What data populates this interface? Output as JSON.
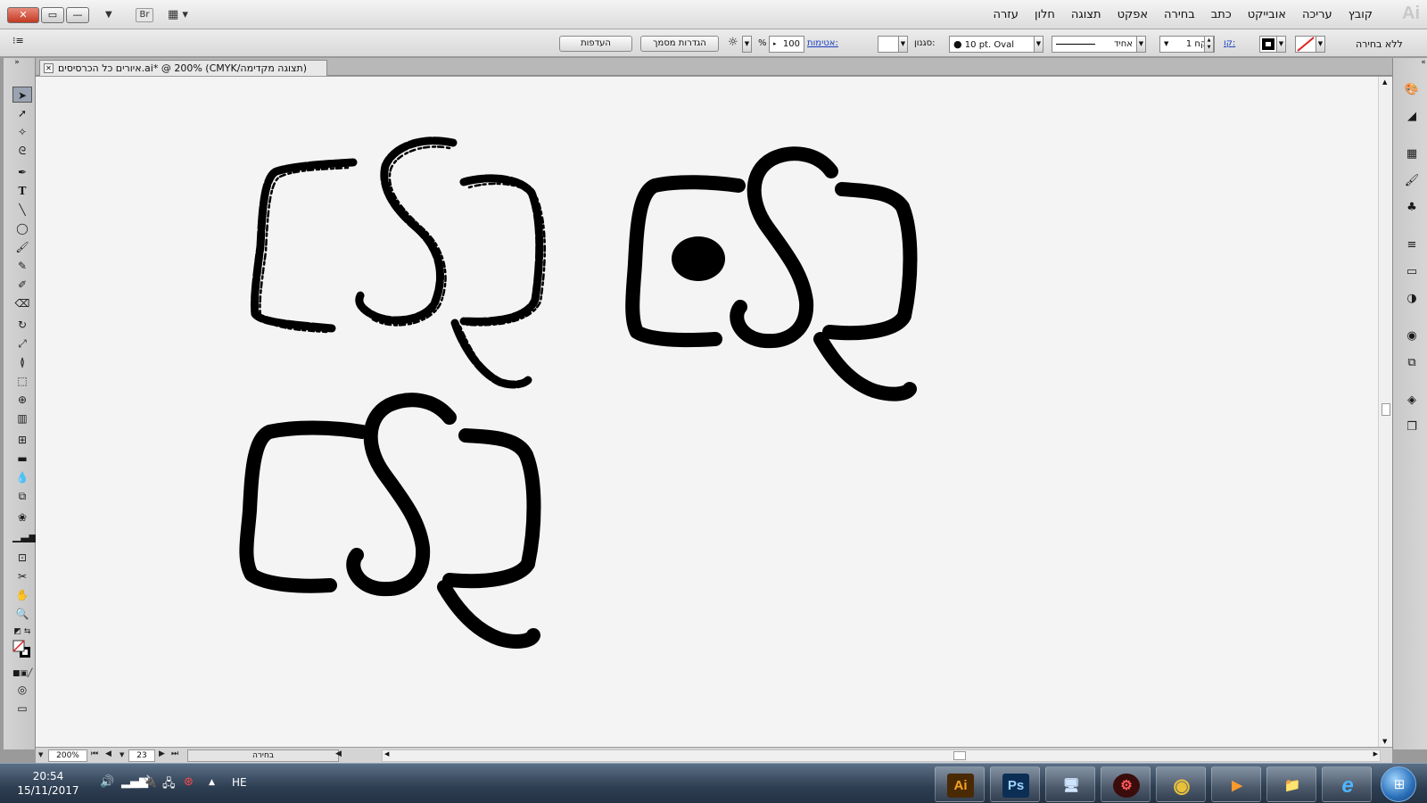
{
  "window": {
    "close_glyph": "✕",
    "restore_glyph": "▭",
    "min_glyph": "—",
    "bridge_label": "Br",
    "app_logo": "Ai"
  },
  "menu": {
    "items": [
      "קובץ",
      "עריכה",
      "אובייקט",
      "כתב",
      "בחירה",
      "אפקט",
      "תצוגה",
      "חלון",
      "עזרה"
    ]
  },
  "control_bar": {
    "selection_status": "ללא בחירה",
    "stroke_label": "קו:",
    "stroke_weight": "1 נקח",
    "stroke_style": "אחיד",
    "brush_label": "סגנון:",
    "brush_value": "10 pt. Oval",
    "opacity_label": "אטימות:",
    "opacity_value": "100",
    "percent": "%",
    "document_setup_button": "הגדרות מסמך",
    "preferences_button": "העדפות"
  },
  "document_tab": {
    "title": "איורים כל הכרסיסים.ai* @ 200% (CMYK/תצוגה מקדימה)",
    "close_glyph": "✕"
  },
  "status_bar": {
    "zoom": "200%",
    "artboard_number": "23",
    "status_text": "בחירה"
  },
  "taskbar": {
    "time": "20:54",
    "date": "15/11/2017",
    "language": "HE",
    "apps": [
      {
        "name": "illustrator",
        "label": "Ai",
        "color": "#f7a226",
        "bg": "#4a2a05"
      },
      {
        "name": "photoshop",
        "label": "Ps",
        "color": "#9dd4ff",
        "bg": "#0c2e55"
      },
      {
        "name": "network-monitor",
        "label": "🖥",
        "color": "#cfe4ff",
        "bg": "transparent"
      },
      {
        "name": "security-app",
        "label": "⚙",
        "color": "#ff5a5a",
        "bg": "#3a0c0c"
      },
      {
        "name": "chrome",
        "label": "◉",
        "color": "#e8c13a",
        "bg": "transparent"
      },
      {
        "name": "media-player",
        "label": "▶",
        "color": "#ff9a2e",
        "bg": "transparent"
      },
      {
        "name": "file-explorer",
        "label": "📁",
        "color": "#f0d070",
        "bg": "transparent"
      },
      {
        "name": "internet-explorer",
        "label": "e",
        "color": "#4fb6ff",
        "bg": "transparent"
      }
    ]
  }
}
